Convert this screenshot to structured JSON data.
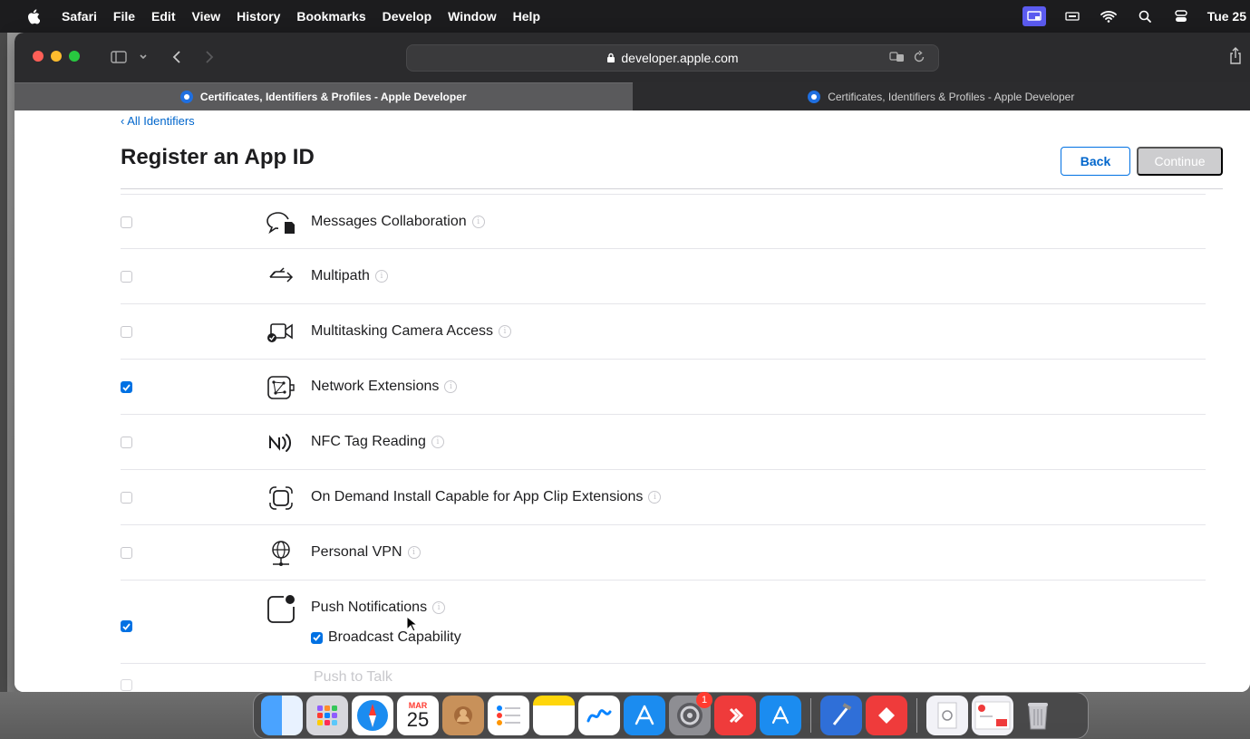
{
  "menubar": {
    "app_name": "Safari",
    "items": [
      "File",
      "Edit",
      "View",
      "History",
      "Bookmarks",
      "Develop",
      "Window",
      "Help"
    ],
    "clock": "Tue 25"
  },
  "toolbar": {
    "url": "developer.apple.com"
  },
  "tabs": [
    {
      "label": "Certificates, Identifiers & Profiles - Apple Developer",
      "active": true
    },
    {
      "label": "Certificates, Identifiers & Profiles - Apple Developer",
      "active": false
    }
  ],
  "page": {
    "back_link": "‹ All Identifiers",
    "title": "Register an App ID",
    "back_button": "Back",
    "continue_button": "Continue"
  },
  "capabilities": [
    {
      "label": "Messages Collaboration",
      "checked": false,
      "icon": "messages-collaboration-icon"
    },
    {
      "label": "Multipath",
      "checked": false,
      "icon": "multipath-icon"
    },
    {
      "label": "Multitasking Camera Access",
      "checked": false,
      "icon": "camera-access-icon"
    },
    {
      "label": "Network Extensions",
      "checked": true,
      "icon": "network-extensions-icon"
    },
    {
      "label": "NFC Tag Reading",
      "checked": false,
      "icon": "nfc-icon"
    },
    {
      "label": "On Demand Install Capable for App Clip Extensions",
      "checked": false,
      "icon": "app-clip-icon"
    },
    {
      "label": "Personal VPN",
      "checked": false,
      "icon": "vpn-globe-icon"
    },
    {
      "label": "Push Notifications",
      "checked": true,
      "icon": "push-notifications-icon",
      "sub_option": {
        "label": "Broadcast Capability",
        "checked": true
      }
    }
  ],
  "partial_row_label": "Push to Talk",
  "dock": {
    "calendar_month": "MAR",
    "calendar_day": "25",
    "settings_badge": "1"
  }
}
